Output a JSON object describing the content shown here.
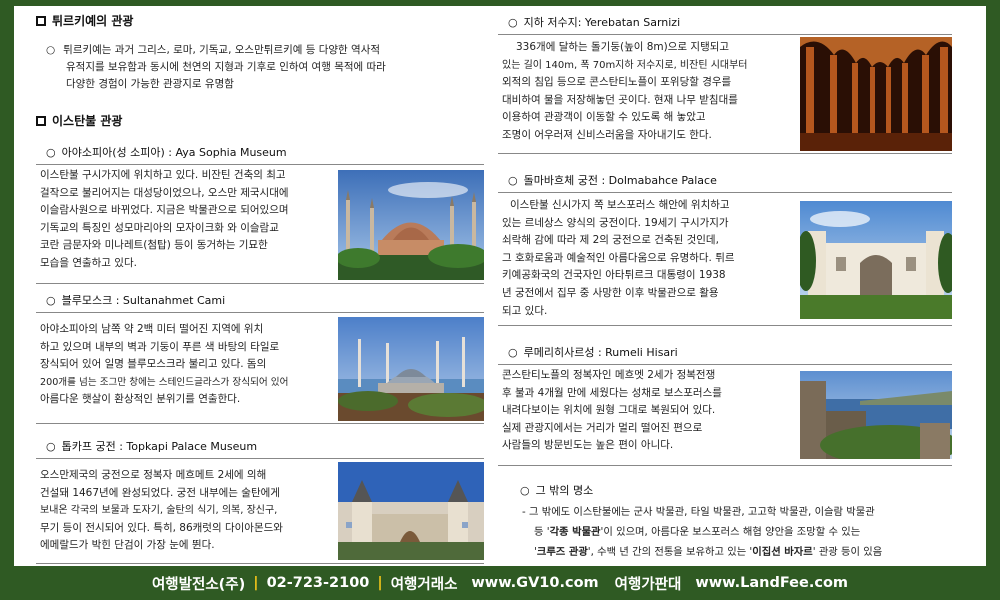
{
  "left": {
    "section1": {
      "title": "튀르키예의 관광",
      "bullet": "○",
      "text_lines": [
        "튀르키예는 과거 그리스, 로마, 기독교, 오스만튀르키예 등 다양한 역사적",
        "유적지를 보유함과 동시에 천연의 지형과 기후로 인하여 여행 목적에 따라",
        "다양한 경험이 가능한 관광지로 유명함"
      ]
    },
    "section2": {
      "title": "이스탄불 관광"
    },
    "aya": {
      "title": "아야소피아(성 소피아) : Aya Sophia Museum",
      "lines": [
        "이스탄불 구시가지에 위치하고 있다. 비잔틴 건축의 최고",
        "걸작으로 불리어지는 대성당이었으나, 오스만 제국시대에",
        "이슬람사원으로 바뀌었다. 지금은 박물관으로 되어있으며",
        "기독교의 특징인 성모마리아의 모자이크화 와 이슬람교",
        "코란 금문자와 미나레트(첨탑) 등이 동거하는 기묘한",
        "모습을 연출하고 있다."
      ]
    },
    "blue": {
      "title": "블루모스크 : Sultanahmet Cami",
      "lines": [
        "아야소피아의 남쪽 약 2백 미터 떨어진 지역에 위치",
        "하고 있으며 내부의 벽과 기둥이 푸른 색 바탕의 타일로",
        "장식되어 있어 일명 블루모스크라 불리고 있다. 돔의",
        "200개를 넘는 조그만 창에는 스테인드글라스가 장식되어 있어",
        "아름다운 햇살이 환상적인 분위기를 연출한다."
      ]
    },
    "topkapi": {
      "title": "톱카프 궁전 : Topkapi Palace Museum",
      "lines": [
        "오스만제국의 궁전으로 정복자 메흐메트 2세에 의해",
        "건설돼 1467년에 완성되었다. 궁전 내부에는 술탄에게",
        "보내온 각국의 보물과 도자기, 술탄의 식기, 의복, 장신구,",
        "무기 등이 전시되어 있다. 특히, 86캐럿의 다이아몬드와",
        "에메랄드가 박힌 단검이 가장 눈에 뛴다."
      ]
    }
  },
  "right": {
    "cistern": {
      "title": "지하 저수지: Yerebatan Sarnizi",
      "lines": [
        "336개에 달하는 돌기둥(높이 8m)으로 지탱되고",
        "있는 길이 140m, 폭 70m지하 저수지로, 비잔틴 시대부터",
        "외적의 침입 등으로 콘스탄티노플이 포위당할 경우를",
        "대비하여 물을 저장해놓던 곳이다. 현재 나무 받침대를",
        "이용하여 관광객이 이동할 수 있도록 해 놓았고",
        "조명이 어우러져 신비스러움을 자아내기도 한다."
      ]
    },
    "dolma": {
      "title": "돌마바흐체 궁전 : Dolmabahce Palace",
      "lines": [
        "이스탄불 신시가지 쪽 보스포러스 해안에 위치하고",
        "있는 르네상스 양식의 궁전이다. 19세기 구시가지가",
        "쇠락해 감에 따라 제 2의 궁전으로 건축된 것인데,",
        "그 호화로움과 예술적인 아름다움으로 유명하다. 튀르",
        "키예공화국의 건국자인 아타튀르크 대통령이 1938",
        "년 궁전에서 집무 중 사망한 이후 박물관으로 활용",
        "되고 있다."
      ]
    },
    "rumeli": {
      "title": "루메리히사르성 : Rumeli Hisari",
      "lines": [
        "콘스탄티노플의 정복자인 메흐멧 2세가 정복전쟁",
        "후 불과 4개월 만에 세웠다는 성채로 보스포러스를",
        "내려다보이는 위치에 원형 그대로 복원되어 있다.",
        "실제 관광지에서는 거리가 멀리 떨어진 편으로",
        "사람들의 방문빈도는 높은 편이 아니다."
      ]
    },
    "others": {
      "title": "그 밖의 명소",
      "line1": "- 그 밖에도 이스탄불에는 군사 박물관, 타일 박물관, 고고학 박물관, 이슬람 박물관",
      "line2_a": "등 '",
      "line2_b": "각종 박물관",
      "line2_c": "'이 있으며, 아름다운 보스포러스 해협 양안을 조망할 수 있는",
      "line3_a": "'",
      "line3_b": "크루즈 관광",
      "line3_c": "', 수백 년 간의 전통을 보유하고 있는 '",
      "line3_d": "이집션 바자르",
      "line3_e": "' 관광 등이 있음"
    }
  },
  "footer": {
    "company": "여행발전소(주)",
    "phone": "02-723-2100",
    "exchange_label": "여행거래소",
    "exchange_url": "www.GV10.com",
    "price_label": "여행가판대",
    "price_url": "www.LandFee.com"
  },
  "colors": {
    "frame": "#2f5a23",
    "separator": "#f0c419"
  },
  "images": [
    "hagia-sophia-photo",
    "blue-mosque-photo",
    "topkapi-photo",
    "cistern-photo",
    "dolmabahce-photo",
    "rumeli-fortress-photo"
  ]
}
